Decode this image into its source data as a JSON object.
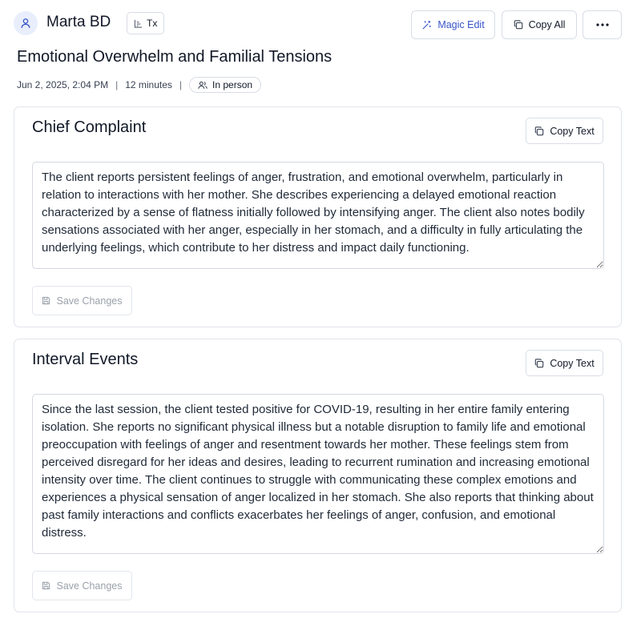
{
  "header": {
    "client_name": "Marta BD",
    "tx_label": "Tx",
    "magic_edit_label": "Magic Edit",
    "copy_all_label": "Copy All",
    "more_label": "···"
  },
  "session": {
    "title": "Emotional Overwhelm and Familial Tensions",
    "datetime": "Jun 2, 2025, 2:04 PM",
    "separator": "|",
    "duration": "12 minutes",
    "mode": "In person"
  },
  "sections": [
    {
      "title": "Chief Complaint",
      "copy_label": "Copy Text",
      "text": "The client reports persistent feelings of anger, frustration, and emotional overwhelm, particularly in relation to interactions with her mother. She describes experiencing a delayed emotional reaction characterized by a sense of flatness initially followed by intensifying anger. The client also notes bodily sensations associated with her anger, especially in her stomach, and a difficulty in fully articulating the underlying feelings, which contribute to her distress and impact daily functioning.",
      "save_label": "Save Changes"
    },
    {
      "title": "Interval Events",
      "copy_label": "Copy Text",
      "text": "Since the last session, the client tested positive for COVID-19, resulting in her entire family entering isolation. She reports no significant physical illness but a notable disruption to family life and emotional preoccupation with feelings of anger and resentment towards her mother. These feelings stem from perceived disregard for her ideas and desires, leading to recurrent rumination and increasing emotional intensity over time. The client continues to struggle with communicating these complex emotions and experiences a physical sensation of anger localized in her stomach. She also reports that thinking about past family interactions and conflicts exacerbates her feelings of anger, confusion, and emotional distress.",
      "save_label": "Save Changes"
    }
  ],
  "icons": {
    "avatar": "user-icon",
    "tx": "list-chart-icon",
    "magic": "magic-wand-icon",
    "copy": "copy-icon",
    "mode": "people-icon",
    "save": "save-icon"
  },
  "colors": {
    "accent": "#3754c9",
    "avatar_bg": "#e8eefb",
    "border": "#d8dde5",
    "disabled_text": "#9aa1ab"
  }
}
